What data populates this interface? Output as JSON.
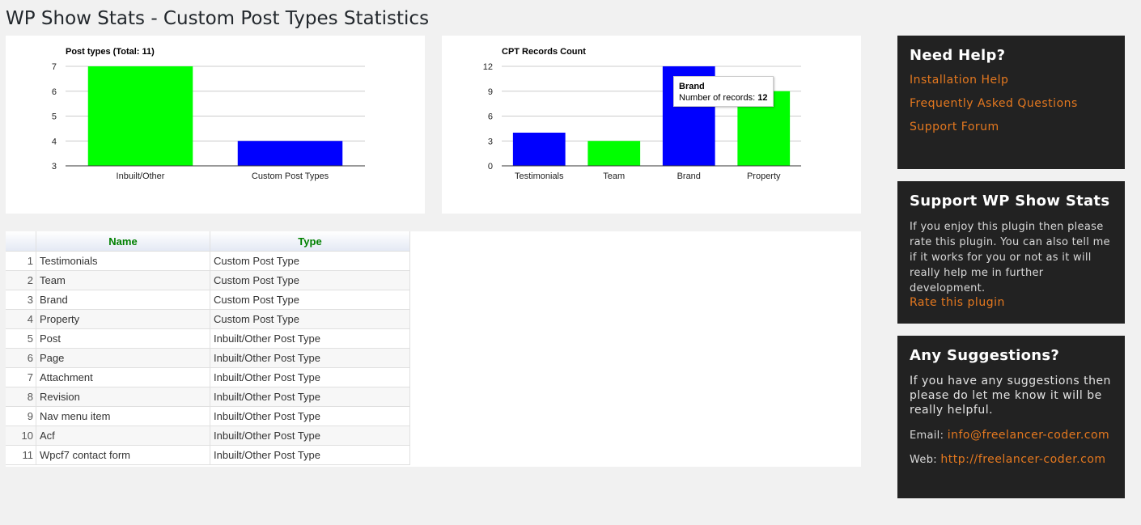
{
  "page": {
    "title": "WP Show Stats - Custom Post Types Statistics"
  },
  "colors": {
    "green": "#00ff00",
    "blue": "#0000ff",
    "accent": "#e4781f",
    "header_text": "#008000"
  },
  "chart_data": [
    {
      "type": "bar",
      "title": "Post types (Total: 11)",
      "categories": [
        "Inbuilt/Other",
        "Custom Post Types"
      ],
      "values": [
        7,
        4
      ],
      "colors": [
        "#00ff00",
        "#0000ff"
      ],
      "ylim": [
        3,
        7
      ],
      "yticks": [
        3,
        4,
        5,
        6,
        7
      ],
      "grid": true
    },
    {
      "type": "bar",
      "title": "CPT Records Count",
      "categories": [
        "Testimonials",
        "Team",
        "Brand",
        "Property"
      ],
      "values": [
        4,
        3,
        12,
        9
      ],
      "colors": [
        "#0000ff",
        "#00ff00",
        "#0000ff",
        "#00ff00"
      ],
      "ylim": [
        0,
        12
      ],
      "yticks": [
        0,
        3,
        6,
        9,
        12
      ],
      "grid": true,
      "tooltip": {
        "title": "Brand",
        "label": "Number of records:",
        "value": "12"
      }
    }
  ],
  "table": {
    "headers": [
      "Name",
      "Type"
    ],
    "rows": [
      {
        "num": "1",
        "name": "Testimonials",
        "type": "Custom Post Type"
      },
      {
        "num": "2",
        "name": "Team",
        "type": "Custom Post Type"
      },
      {
        "num": "3",
        "name": "Brand",
        "type": "Custom Post Type"
      },
      {
        "num": "4",
        "name": "Property",
        "type": "Custom Post Type"
      },
      {
        "num": "5",
        "name": "Post",
        "type": "Inbuilt/Other Post Type"
      },
      {
        "num": "6",
        "name": "Page",
        "type": "Inbuilt/Other Post Type"
      },
      {
        "num": "7",
        "name": "Attachment",
        "type": "Inbuilt/Other Post Type"
      },
      {
        "num": "8",
        "name": "Revision",
        "type": "Inbuilt/Other Post Type"
      },
      {
        "num": "9",
        "name": "Nav menu item",
        "type": "Inbuilt/Other Post Type"
      },
      {
        "num": "10",
        "name": "Acf",
        "type": "Inbuilt/Other Post Type"
      },
      {
        "num": "11",
        "name": "Wpcf7 contact form",
        "type": "Inbuilt/Other Post Type"
      }
    ]
  },
  "sidebar": {
    "help": {
      "title": "Need Help?",
      "links": [
        "Installation Help",
        "Frequently Asked Questions",
        "Support Forum"
      ]
    },
    "support": {
      "title": "Support WP Show Stats",
      "text": "If you enjoy this plugin then please rate this plugin. You can also tell me if it works for you or not as it will really help me in further development.",
      "link": "Rate this plugin"
    },
    "suggestions": {
      "title": "Any Suggestions?",
      "text": "If you have any suggestions then please do let me know it will be really helpful.",
      "email_label": "Email:",
      "email": "info@freelancer-coder.com",
      "web_label": "Web:",
      "web": "http://freelancer-coder.com"
    }
  }
}
